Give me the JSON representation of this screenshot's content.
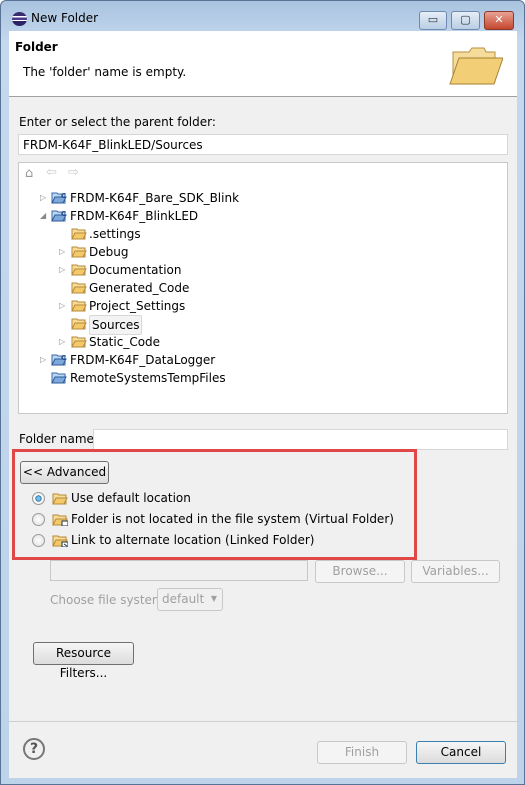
{
  "window": {
    "title": "New Folder",
    "minimize": "▭",
    "maximize": "▢",
    "close": "✕"
  },
  "header": {
    "title": "Folder",
    "message": "The 'folder' name is empty."
  },
  "parent": {
    "label": "Enter or select the parent folder:",
    "value": "FRDM-K64F_BlinkLED/Sources"
  },
  "tree": {
    "items": [
      {
        "label": "FRDM-K64F_Bare_SDK_Blink",
        "level": 0,
        "expander": "collapsed",
        "type": "project"
      },
      {
        "label": "FRDM-K64F_BlinkLED",
        "level": 0,
        "expander": "expanded",
        "type": "project"
      },
      {
        "label": ".settings",
        "level": 1,
        "expander": "none",
        "type": "folder"
      },
      {
        "label": "Debug",
        "level": 1,
        "expander": "collapsed",
        "type": "folder"
      },
      {
        "label": "Documentation",
        "level": 1,
        "expander": "collapsed",
        "type": "folder"
      },
      {
        "label": "Generated_Code",
        "level": 1,
        "expander": "none",
        "type": "folder"
      },
      {
        "label": "Project_Settings",
        "level": 1,
        "expander": "collapsed",
        "type": "folder"
      },
      {
        "label": "Sources",
        "level": 1,
        "expander": "none",
        "type": "folder",
        "selected": true
      },
      {
        "label": "Static_Code",
        "level": 1,
        "expander": "collapsed",
        "type": "folder"
      },
      {
        "label": "FRDM-K64F_DataLogger",
        "level": 0,
        "expander": "collapsed",
        "type": "project"
      },
      {
        "label": "RemoteSystemsTempFiles",
        "level": 0,
        "expander": "none",
        "type": "plainproject"
      }
    ]
  },
  "folder_name": {
    "label": "Folder name:",
    "value": ""
  },
  "advanced": {
    "label": "<< Advanced"
  },
  "location_options": [
    {
      "label": "Use default location",
      "checked": true
    },
    {
      "label": "Folder is not located in the file system (Virtual Folder)",
      "checked": false
    },
    {
      "label": "Link to alternate location (Linked Folder)",
      "checked": false
    }
  ],
  "link": {
    "value": "",
    "browse": "Browse...",
    "variables": "Variables...",
    "fs_label": "Choose file system:",
    "fs_value": "default"
  },
  "resource_filters": "Resource Filters...",
  "footer": {
    "help": "?",
    "finish": "Finish",
    "cancel": "Cancel"
  },
  "colors": {
    "highlight": "#e04848",
    "folder": "#f0c060"
  }
}
